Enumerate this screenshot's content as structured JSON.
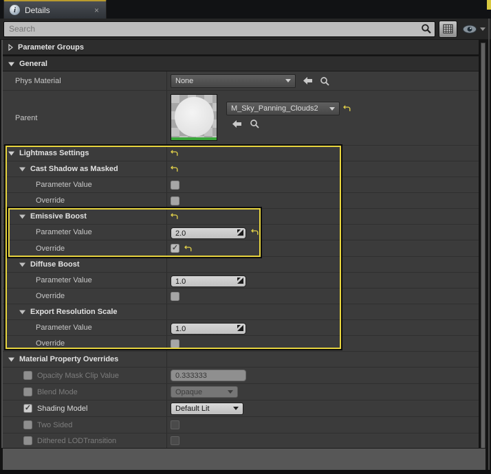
{
  "window": {
    "tab_title": "Details",
    "close_glyph": "×",
    "info_glyph": "i"
  },
  "toolbar": {
    "search_placeholder": "Search"
  },
  "sections": {
    "parameter_groups": {
      "title": "Parameter Groups"
    },
    "general": {
      "title": "General",
      "phys_material_label": "Phys Material",
      "phys_material_value": "None",
      "parent_label": "Parent",
      "parent_value": "M_Sky_Panning_Clouds2"
    },
    "lightmass": {
      "title": "Lightmass Settings",
      "cast_shadow_title": "Cast Shadow as Masked",
      "cast_shadow_param_label": "Parameter Value",
      "cast_shadow_param_checked": false,
      "cast_shadow_override_label": "Override",
      "cast_shadow_override_checked": false,
      "emissive_title": "Emissive Boost",
      "emissive_param_label": "Parameter Value",
      "emissive_param_value": "2.0",
      "emissive_override_label": "Override",
      "emissive_override_checked": true,
      "diffuse_title": "Diffuse Boost",
      "diffuse_param_label": "Parameter Value",
      "diffuse_param_value": "1.0",
      "diffuse_override_label": "Override",
      "diffuse_override_checked": false,
      "export_title": "Export Resolution Scale",
      "export_param_label": "Parameter Value",
      "export_param_value": "1.0",
      "export_override_label": "Override",
      "export_override_checked": false
    },
    "mpo": {
      "title": "Material Property Overrides",
      "opacity_label": "Opacity Mask Clip Value",
      "opacity_value": "0.333333",
      "opacity_enabled": false,
      "blend_label": "Blend Mode",
      "blend_value": "Opaque",
      "blend_enabled": false,
      "shading_label": "Shading Model",
      "shading_value": "Default Lit",
      "shading_enabled": true,
      "two_sided_label": "Two Sided",
      "two_sided_enabled": false,
      "dithered_label": "Dithered LODTransition",
      "dithered_enabled": false
    }
  },
  "colors": {
    "highlight_yellow": "#e8d53f",
    "tab_accent_yellow": "#b99b2e",
    "thumbnail_bar_green": "#3aa83a",
    "row_background": "#3b3b3b"
  }
}
